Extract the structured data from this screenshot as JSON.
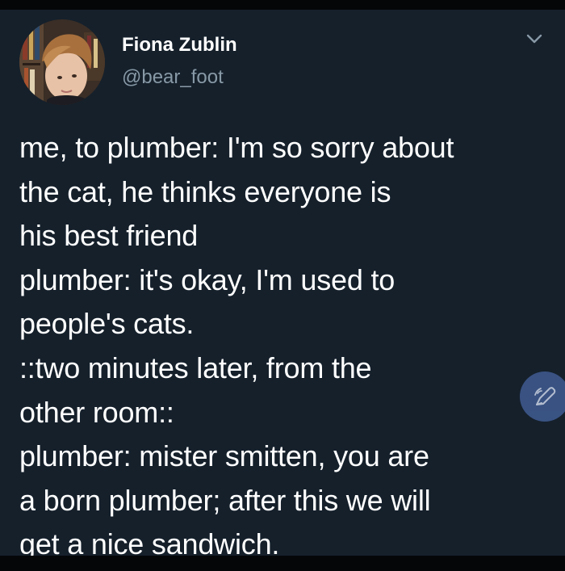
{
  "tweet": {
    "author": {
      "display_name": "Fiona Zublin",
      "handle": "@bear_foot"
    },
    "text_lines": [
      "me, to plumber: I'm so sorry about",
      "the cat, he thinks everyone is",
      "his best friend",
      "plumber: it's okay, I'm used to",
      "people's cats.",
      "::two minutes later, from the",
      "other room::",
      "plumber: mister smitten, you are",
      "a born plumber; after this we will",
      "get a nice sandwich."
    ]
  },
  "icons": {
    "more_menu": "chevron-down-icon",
    "compose": "feather-compose-icon"
  },
  "colors": {
    "background": "#15202b",
    "text_primary": "#ffffff",
    "text_secondary": "#8899a6",
    "fab": "#3f5a8f"
  }
}
